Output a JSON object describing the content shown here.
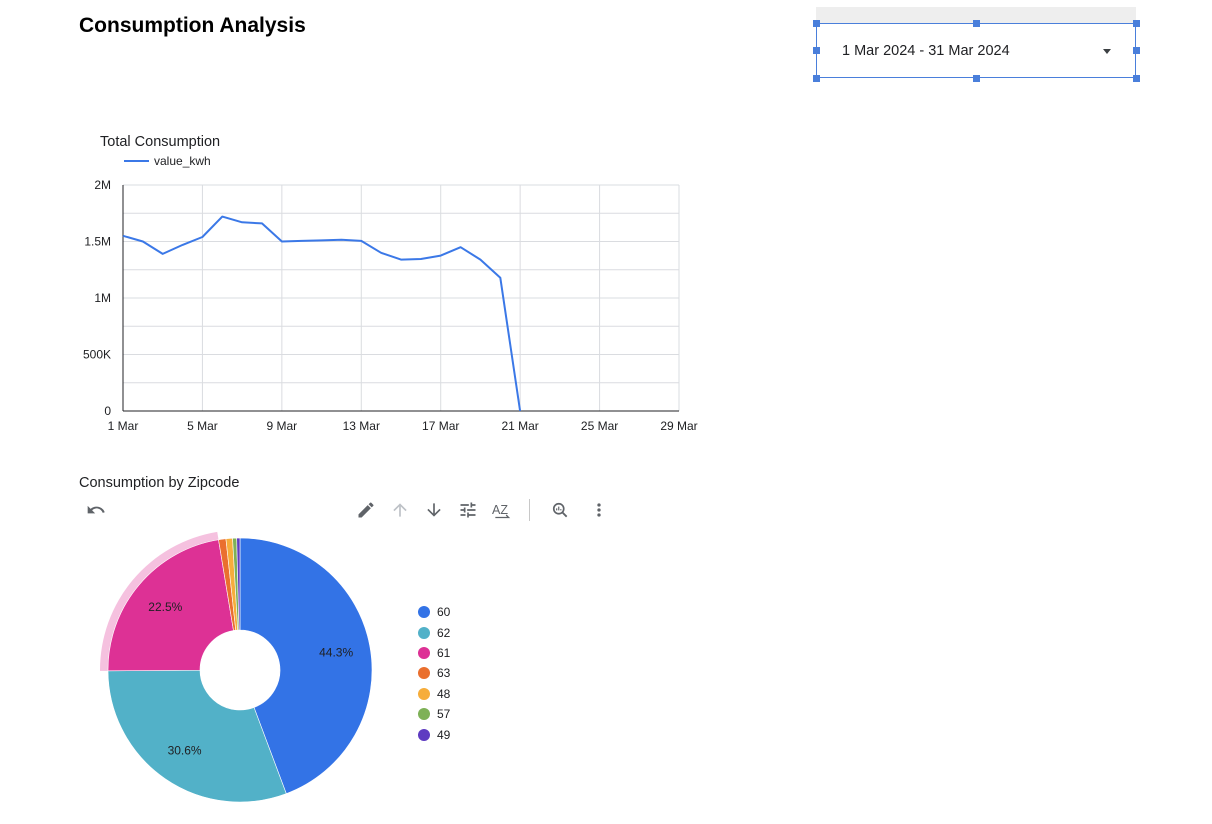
{
  "page": {
    "title": "Consumption Analysis"
  },
  "date_control": {
    "value": "1 Mar 2024 - 31 Mar 2024"
  },
  "colors": {
    "accent": "#4a7fdb",
    "line": "#3b78e7",
    "grid": "#dadce0",
    "axis": "#202124"
  },
  "toolbar": {
    "icons": [
      "undo-icon",
      "pencil-icon",
      "arrow-up-icon",
      "arrow-down-icon",
      "tune-icon",
      "sort-az-icon",
      "zoom-icon",
      "more-vert-icon"
    ]
  },
  "chart_data": [
    {
      "type": "line",
      "title": "Total Consumption",
      "xlabel": "",
      "ylabel": "",
      "ylim": [
        0,
        2000000
      ],
      "xlim": [
        "2024-03-01",
        "2024-03-29"
      ],
      "y_ticks": [
        {
          "value": 0,
          "label": "0"
        },
        {
          "value": 500000,
          "label": "500K"
        },
        {
          "value": 1000000,
          "label": "1M"
        },
        {
          "value": 1500000,
          "label": "1.5M"
        },
        {
          "value": 2000000,
          "label": "2M"
        }
      ],
      "x_ticks": [
        {
          "value": "2024-03-01",
          "label": "1 Mar"
        },
        {
          "value": "2024-03-05",
          "label": "5 Mar"
        },
        {
          "value": "2024-03-09",
          "label": "9 Mar"
        },
        {
          "value": "2024-03-13",
          "label": "13 Mar"
        },
        {
          "value": "2024-03-17",
          "label": "17 Mar"
        },
        {
          "value": "2024-03-21",
          "label": "21 Mar"
        },
        {
          "value": "2024-03-25",
          "label": "25 Mar"
        },
        {
          "value": "2024-03-29",
          "label": "29 Mar"
        }
      ],
      "grid": true,
      "legend": "top-left",
      "series": [
        {
          "name": "value_kwh",
          "x": [
            "2024-03-01",
            "2024-03-02",
            "2024-03-03",
            "2024-03-04",
            "2024-03-05",
            "2024-03-06",
            "2024-03-07",
            "2024-03-08",
            "2024-03-09",
            "2024-03-10",
            "2024-03-11",
            "2024-03-12",
            "2024-03-13",
            "2024-03-14",
            "2024-03-15",
            "2024-03-16",
            "2024-03-17",
            "2024-03-18",
            "2024-03-19",
            "2024-03-20",
            "2024-03-21"
          ],
          "values": [
            1550000,
            1500000,
            1390000,
            1470000,
            1540000,
            1720000,
            1670000,
            1660000,
            1500000,
            1505000,
            1510000,
            1515000,
            1505000,
            1400000,
            1340000,
            1345000,
            1375000,
            1450000,
            1340000,
            1180000,
            0
          ]
        }
      ]
    },
    {
      "type": "pie",
      "title": "Consumption by Zipcode",
      "legend": "right",
      "donut": true,
      "slices": [
        {
          "label": "60",
          "value": 44.3,
          "color": "#3373e6",
          "data_label": "44.3%"
        },
        {
          "label": "62",
          "value": 30.6,
          "color": "#52b1c8",
          "data_label": "30.6%"
        },
        {
          "label": "61",
          "value": 22.5,
          "color": "#dd3195",
          "data_label": "22.5%"
        },
        {
          "label": "63",
          "value": 0.9,
          "color": "#ea6f2e",
          "data_label": ""
        },
        {
          "label": "48",
          "value": 0.8,
          "color": "#f6ad3b",
          "data_label": ""
        },
        {
          "label": "57",
          "value": 0.5,
          "color": "#7eb157",
          "data_label": ""
        },
        {
          "label": "49",
          "value": 0.4,
          "color": "#5e3bc1",
          "data_label": ""
        }
      ],
      "highlighted_slice": "61"
    }
  ]
}
